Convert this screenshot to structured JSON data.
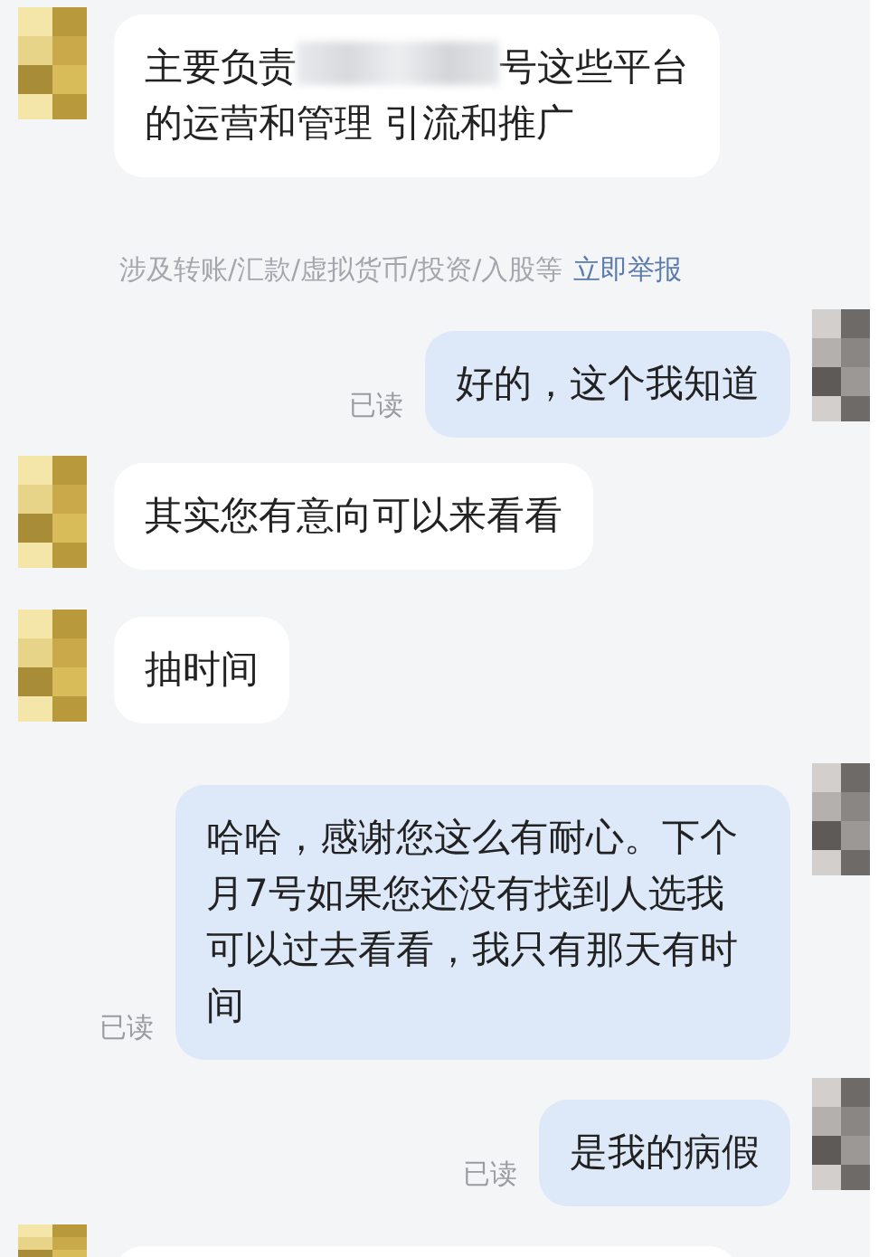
{
  "messages": [
    {
      "kind": "incoming",
      "segments": [
        {
          "kind": "text",
          "text": "主要负责"
        },
        {
          "kind": "redacted"
        },
        {
          "kind": "text",
          "text": "号这些平台"
        },
        {
          "kind": "line",
          "text": "的运营和管理 引流和推广"
        }
      ]
    },
    {
      "kind": "notice",
      "text": "涉及转账/汇款/虚拟货币/投资/入股等",
      "link": "立即举报"
    },
    {
      "kind": "outgoing",
      "read": "已读",
      "segments": [
        {
          "kind": "text",
          "text": "好的，这个我知道"
        }
      ]
    },
    {
      "kind": "incoming",
      "segments": [
        {
          "kind": "text",
          "text": "其实您有意向可以来看看"
        }
      ]
    },
    {
      "kind": "incoming",
      "segments": [
        {
          "kind": "text",
          "text": "抽时间"
        }
      ]
    },
    {
      "kind": "outgoing",
      "read": "已读",
      "segments": [
        {
          "kind": "text",
          "text": "哈哈，感谢您这么有耐心。下个月7号如果您还没有找到人选我可以过去看看，我只有那天有时间"
        }
      ]
    },
    {
      "kind": "outgoing",
      "read": "已读",
      "segments": [
        {
          "kind": "text",
          "text": "是我的病假"
        }
      ]
    },
    {
      "kind": "incoming"
    }
  ]
}
